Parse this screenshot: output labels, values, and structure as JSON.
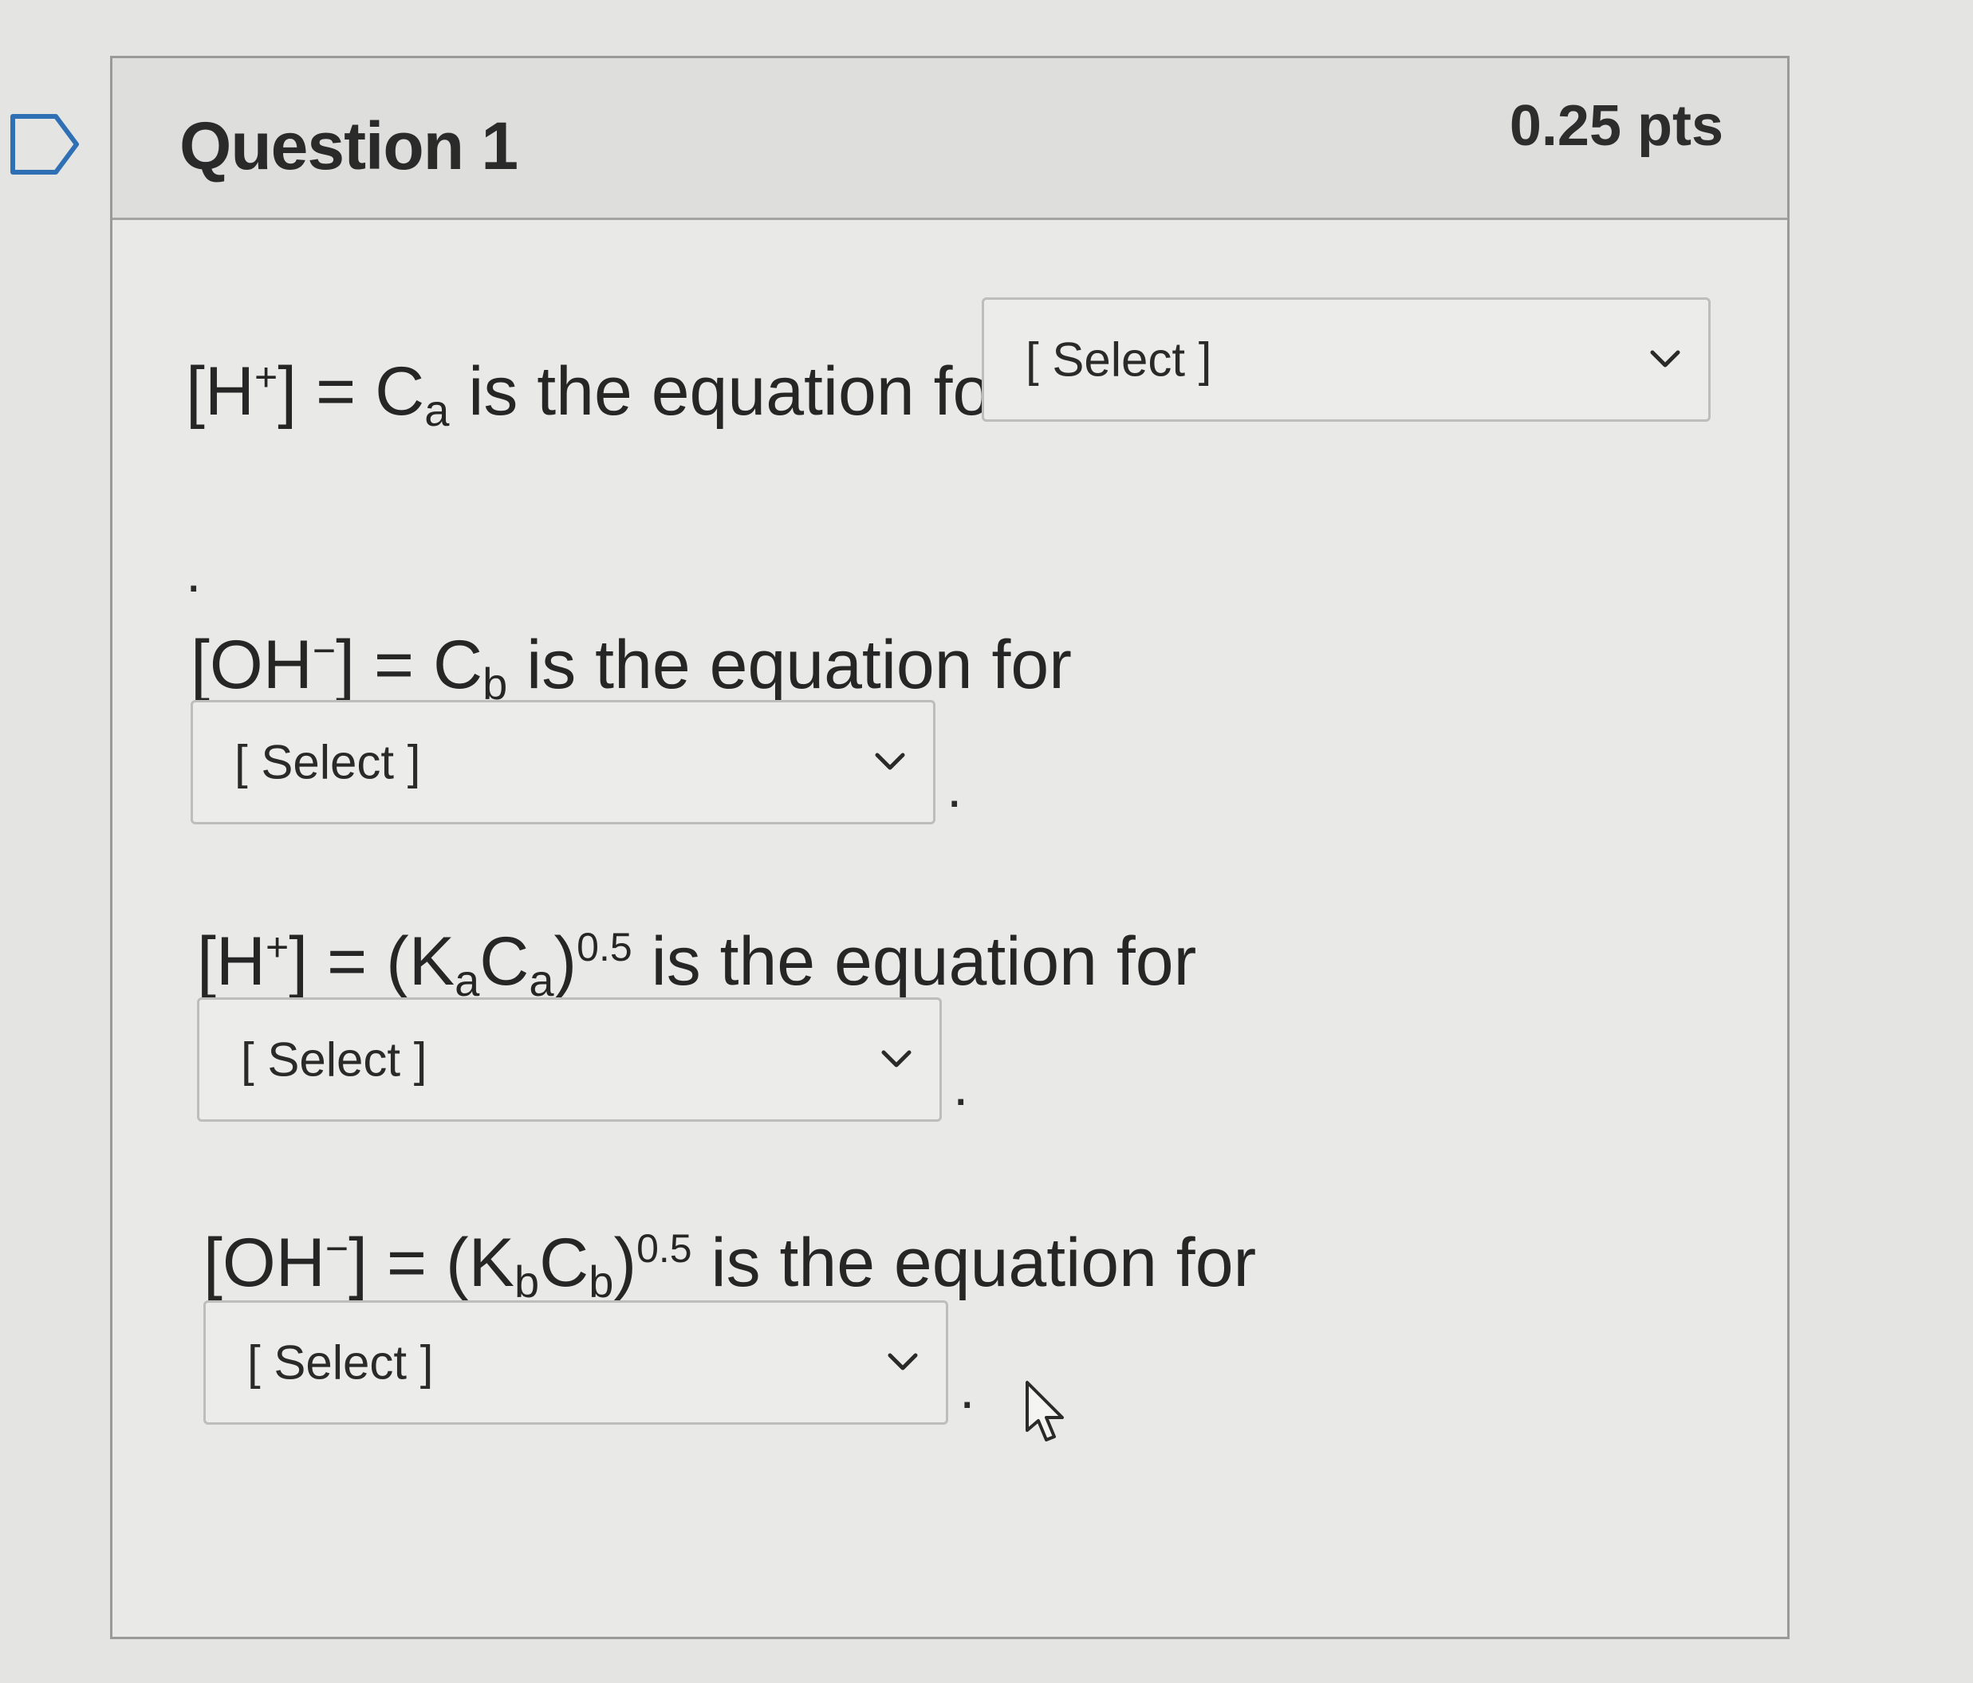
{
  "question": {
    "title": "Question 1",
    "points": "0.25 pts"
  },
  "items": [
    {
      "equation_prefix": "[H",
      "equation_sup": "+",
      "equation_mid": "] = C",
      "equation_sub": "a",
      "equation_suffix": " is the equation for",
      "select_value": "[ Select ]",
      "trailing": "."
    },
    {
      "equation_prefix": "[OH",
      "equation_sup": "−",
      "equation_mid": "] = C",
      "equation_sub": "b",
      "equation_suffix": " is the equation for",
      "select_value": "[ Select ]",
      "trailing": "."
    },
    {
      "equation_prefix": "[H",
      "equation_sup": "+",
      "equation_mid": "] = (K",
      "equation_sub": "a",
      "equation_mid2": "C",
      "equation_sub2": "a",
      "equation_paren": ")",
      "equation_exp": "0.5",
      "equation_suffix": " is the equation for",
      "select_value": "[ Select ]",
      "trailing": "."
    },
    {
      "equation_prefix": "[OH",
      "equation_sup": "−",
      "equation_mid": "] = (K",
      "equation_sub": "b",
      "equation_mid2": "C",
      "equation_sub2": "b",
      "equation_paren": ")",
      "equation_exp": "0.5",
      "equation_suffix": " is the equation for",
      "select_value": "[ Select ]",
      "trailing": "."
    }
  ],
  "icons": {
    "flag": "flag-icon",
    "chevron": "chevron-down-icon",
    "cursor": "cursor-icon"
  }
}
